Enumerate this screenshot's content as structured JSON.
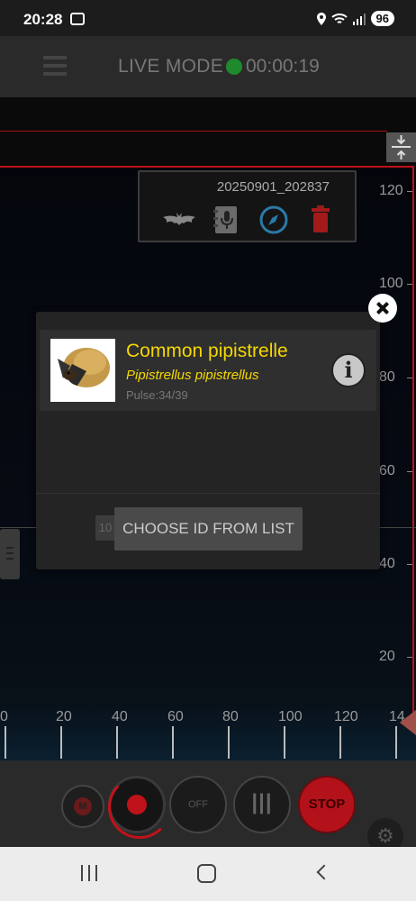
{
  "status_bar": {
    "time": "20:28",
    "battery": "96"
  },
  "header": {
    "title": "LIVE MODE",
    "timer": "00:00:19",
    "live_indicator_color": "#1f8a2c"
  },
  "recording_info": {
    "id": "20250901_202837",
    "icons": [
      "bat-icon",
      "notebook-microphone-icon",
      "compass-icon",
      "trash-icon"
    ]
  },
  "y_axis": {
    "labels": [
      "120",
      "100",
      "80",
      "60",
      "40",
      "20"
    ]
  },
  "x_axis": {
    "labels": [
      "0",
      "20",
      "40",
      "60",
      "80",
      "100",
      "120",
      "14"
    ]
  },
  "dialog": {
    "species": {
      "common_name": "Common pipistrelle",
      "scientific_name": "Pipistrellus pipistrellus",
      "pulse": "Pulse:34/39",
      "name_color": "#f5d800"
    },
    "info_button_label": "i",
    "choose_button_label": "CHOOSE ID FROM LIST",
    "behind_button_label": "10"
  },
  "controls": {
    "m_label": "M",
    "off_label": "OFF",
    "pause_label": "|||",
    "stop_label": "STOP",
    "stop_color": "#b3121a"
  }
}
